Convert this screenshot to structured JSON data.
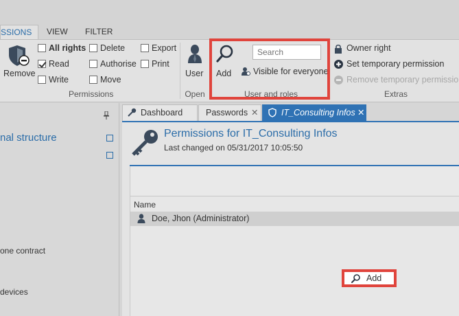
{
  "ribbon_tabs": [
    "SSIONS",
    "VIEW",
    "FILTER"
  ],
  "permissions_group": {
    "remove_label": "Remove",
    "all_rights": "All rights",
    "read": "Read",
    "write": "Write",
    "delete": "Delete",
    "authorise": "Authorise",
    "move": "Move",
    "export": "Export",
    "print": "Print",
    "group_label": "Permissions",
    "checked": {
      "all_rights": false,
      "read": true,
      "write": false,
      "delete": false,
      "authorise": false,
      "move": false,
      "export": false,
      "print": false
    }
  },
  "open_group": {
    "user_label": "User",
    "group_label": "Open"
  },
  "user_roles_group": {
    "add_label": "Add",
    "search_placeholder": "Search",
    "visible_label": "Visible for everyone",
    "group_label": "User and roles"
  },
  "extras_group": {
    "owner_right": "Owner right",
    "set_temp": "Set temporary permission",
    "remove_temp": "Remove temporary permission",
    "group_label": "Extras"
  },
  "left_pane": {
    "heading": "nal structure",
    "items": [
      "one contract",
      "devices"
    ]
  },
  "doc_tabs": [
    "Dashboard",
    "Passwords",
    "IT_Consulting Infos"
  ],
  "doc": {
    "title": "Permissions for IT_Consulting Infos",
    "subtitle": "Last changed on 05/31/2017 10:05:50",
    "column_name": "Name",
    "rows": [
      "Doe, Jhon (Administrator)"
    ],
    "add_button": "Add"
  },
  "colors": {
    "accent": "#2f72b4",
    "highlight": "#e0443c"
  }
}
